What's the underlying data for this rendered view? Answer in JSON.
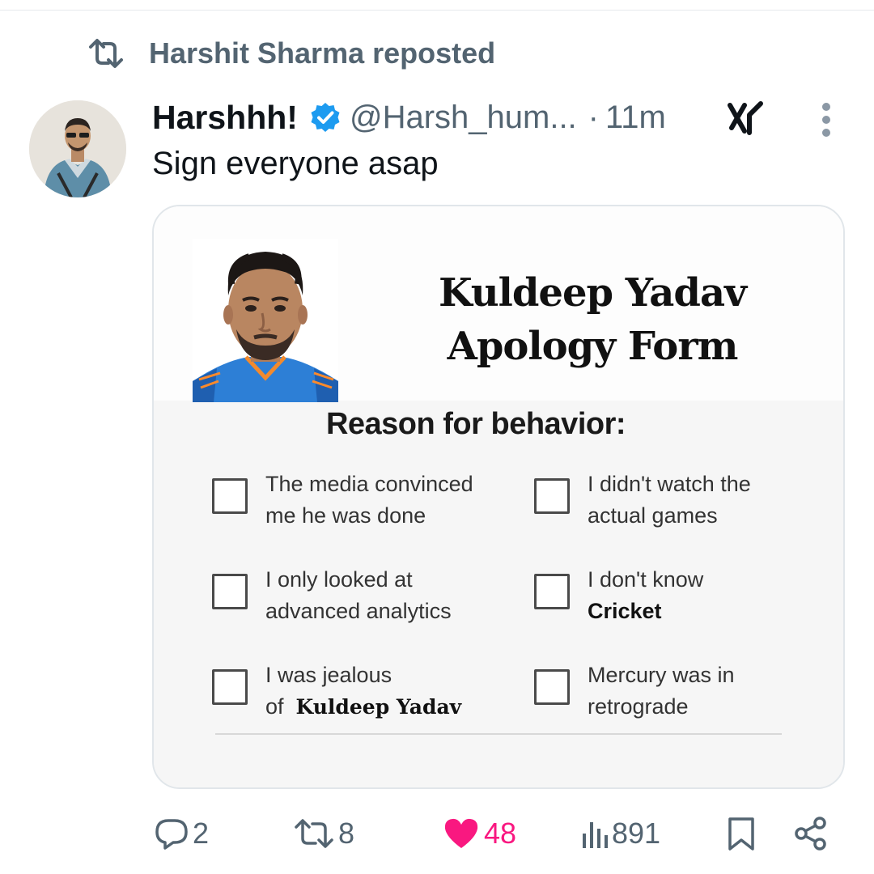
{
  "repost": {
    "icon": "repost-icon",
    "text": "Harshit Sharma reposted"
  },
  "author": {
    "display_name": "Harshhh!",
    "verified_icon": "verified-badge-icon",
    "handle": "@Harsh_hum...",
    "separator": "·",
    "time": "11m"
  },
  "tweet": {
    "text": "Sign everyone asap"
  },
  "media": {
    "title_line1": "Kuldeep Yadav",
    "title_line2": "Apology Form",
    "reason_title": "Reason for behavior:",
    "options": [
      {
        "line1": "The media convinced",
        "line2": "me he was done"
      },
      {
        "line1": "I didn't watch the",
        "line2": "actual games"
      },
      {
        "line1": "I only looked at",
        "line2": "advanced analytics"
      },
      {
        "line1": "I don't know",
        "line2": "Cricket"
      },
      {
        "line1": "I was jealous",
        "line2_prefix": "of",
        "line2": "Kuldeep Yadav"
      },
      {
        "line1": "Mercury was in",
        "line2": "retrograde"
      }
    ]
  },
  "actions": {
    "replies": "2",
    "reposts": "8",
    "likes": "48",
    "views": "891"
  },
  "colors": {
    "text": "#0f1419",
    "secondary": "#536471",
    "verified": "#1d9bf0",
    "like": "#f91880",
    "jersey": "#2d7fd6"
  }
}
